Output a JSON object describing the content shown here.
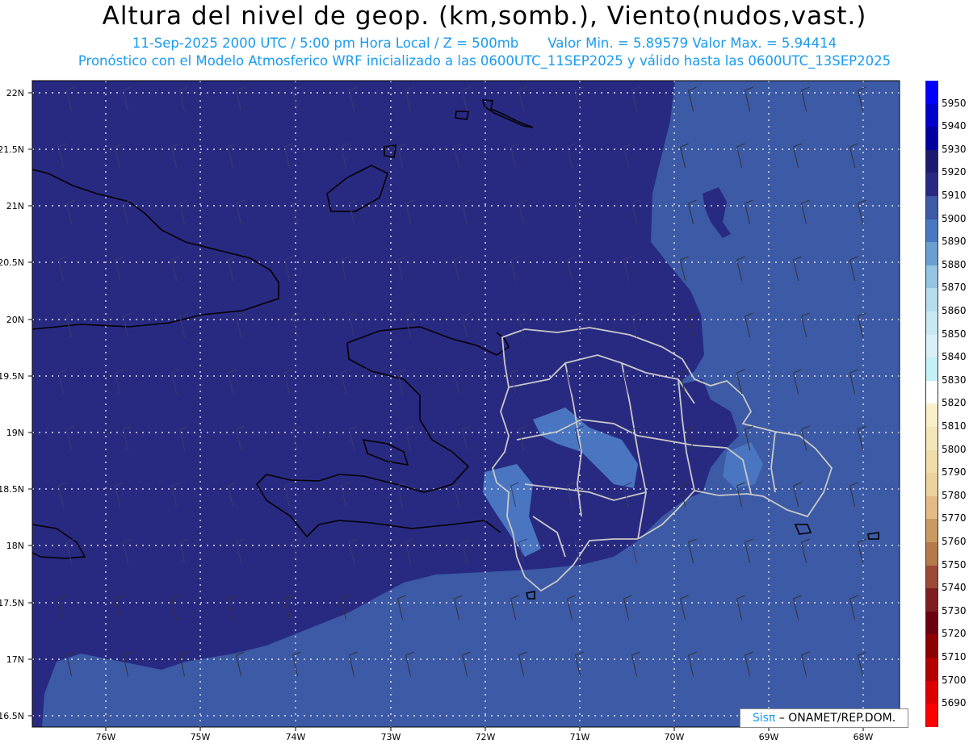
{
  "header": {
    "title": "Altura del nivel de geop. (km,somb.), Viento(nudos,vast.)",
    "line2": "11-Sep-2025  2000 UTC / 5:00 pm Hora Local / Z = 500mb",
    "line2_values": "Valor Min. = 5.89579  Valor Max. = 5.94414",
    "line3": "Pronóstico con el Modelo Atmosferico WRF inicializado a las 0600UTC_11SEP2025 y válido hasta las  0600UTC_13SEP2025"
  },
  "map": {
    "lat_labels": [
      "22N",
      "21.5N",
      "21N",
      "20.5N",
      "20N",
      "19.5N",
      "19N",
      "18.5N",
      "18N",
      "17.5N",
      "17N",
      "16.5N"
    ],
    "lon_labels": [
      "76W",
      "75W",
      "74W",
      "73W",
      "72W",
      "71W",
      "70W",
      "69W",
      "68W"
    ],
    "colors": {
      "z5910": "#282a82",
      "z5900": "#3c5aa6",
      "z5890": "#4a75c0"
    }
  },
  "colorbar": [
    {
      "label": "5950",
      "color": "#0000ff"
    },
    {
      "label": "5940",
      "color": "#0000cd"
    },
    {
      "label": "5930",
      "color": "#0000a0"
    },
    {
      "label": "5920",
      "color": "#1a1a70"
    },
    {
      "label": "5910",
      "color": "#282a82"
    },
    {
      "label": "5900",
      "color": "#3c5aa6"
    },
    {
      "label": "5890",
      "color": "#4a78c0"
    },
    {
      "label": "5880",
      "color": "#6a9fd0"
    },
    {
      "label": "5870",
      "color": "#94c4e0"
    },
    {
      "label": "5860",
      "color": "#b4dcec"
    },
    {
      "label": "5850",
      "color": "#c8e8f2"
    },
    {
      "label": "5840",
      "color": "#d8f0f8"
    },
    {
      "label": "5830",
      "color": "#c4f0f8"
    },
    {
      "label": "5820",
      "color": "#ffffff"
    },
    {
      "label": "5810",
      "color": "#faf0c8"
    },
    {
      "label": "5800",
      "color": "#f4e6b8"
    },
    {
      "label": "5790",
      "color": "#f0ddaa"
    },
    {
      "label": "5780",
      "color": "#ecd29c"
    },
    {
      "label": "5770",
      "color": "#e2bc84"
    },
    {
      "label": "5760",
      "color": "#c99a64"
    },
    {
      "label": "5750",
      "color": "#b57a4c"
    },
    {
      "label": "5740",
      "color": "#9a4a34"
    },
    {
      "label": "5730",
      "color": "#7e1e20"
    },
    {
      "label": "5720",
      "color": "#6a0010"
    },
    {
      "label": "5710",
      "color": "#8c0000"
    },
    {
      "label": "5700",
      "color": "#b40000"
    },
    {
      "label": "5690",
      "color": "#dc0000"
    },
    {
      "label": "",
      "color": "#ff0000"
    }
  ],
  "credit": {
    "sis": "Sisπ",
    "rest": "– ONAMET/REP.DOM."
  }
}
